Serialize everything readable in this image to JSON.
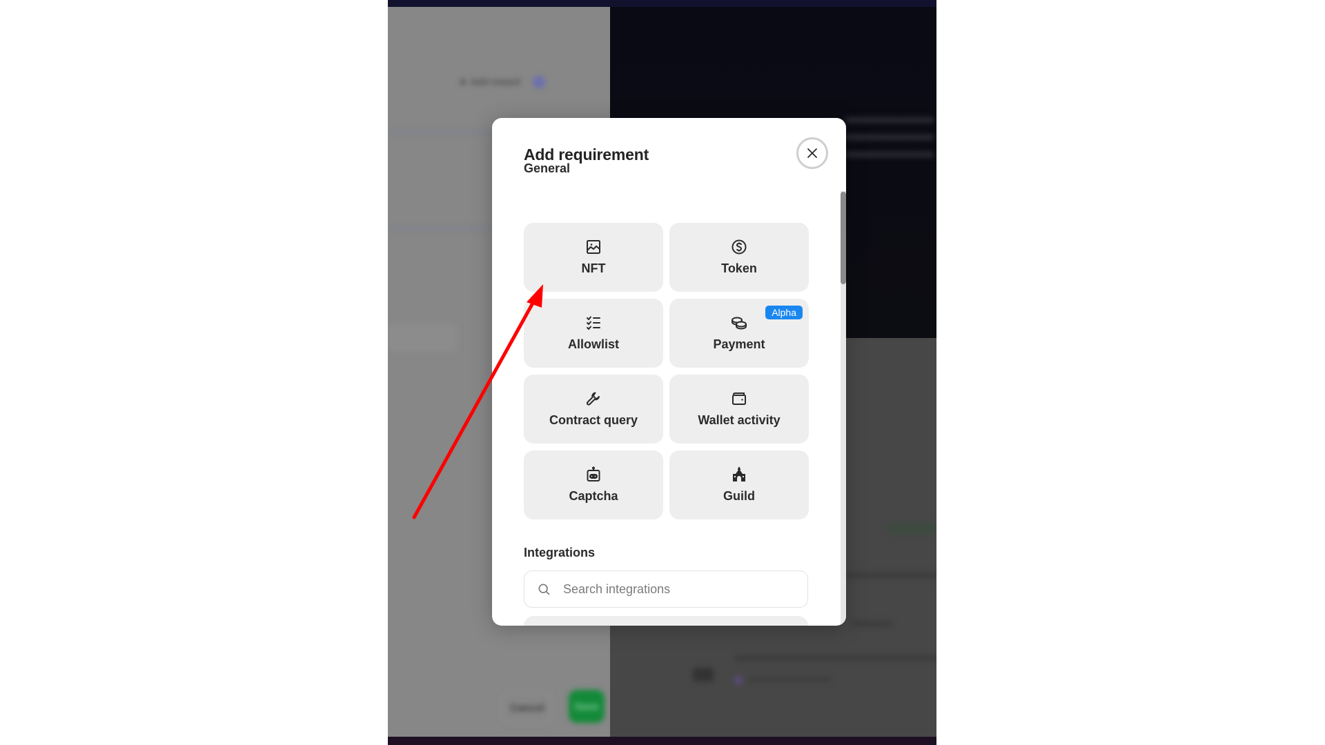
{
  "background": {
    "left_panel": {
      "link_label": "Add reward",
      "cancel_label": "Cancel",
      "save_label": "Save"
    }
  },
  "modal": {
    "title": "Add requirement",
    "close_icon": "close-icon",
    "general": {
      "label": "General",
      "items": [
        {
          "label": "NFT",
          "icon": "image-icon"
        },
        {
          "label": "Token",
          "icon": "dollar-coin-icon"
        },
        {
          "label": "Allowlist",
          "icon": "checklist-icon"
        },
        {
          "label": "Payment",
          "icon": "coins-icon",
          "badge": "Alpha"
        },
        {
          "label": "Contract query",
          "icon": "wrench-icon"
        },
        {
          "label": "Wallet activity",
          "icon": "wallet-icon"
        },
        {
          "label": "Captcha",
          "icon": "robot-icon"
        },
        {
          "label": "Guild",
          "icon": "castle-icon"
        }
      ]
    },
    "integrations": {
      "label": "Integrations",
      "search_placeholder": "Search integrations",
      "search_value": ""
    }
  },
  "colors": {
    "badge": "#1a86f0",
    "annotation_arrow": "#ff0000",
    "tile_bg": "#eeeeee",
    "save_button": "#138a38"
  }
}
